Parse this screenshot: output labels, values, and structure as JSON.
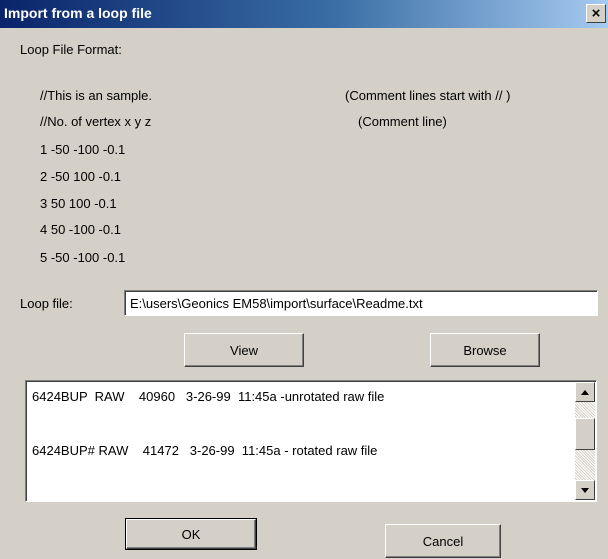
{
  "window": {
    "title": "Import from a loop file",
    "close_glyph": "×"
  },
  "format": {
    "heading": "Loop File Format:",
    "sample_lines": [
      "//This is an sample.",
      "//No. of vertex  x  y  z",
      "1  -50  -100  -0.1",
      "2  -50  100  -0.1",
      "3  50  100  -0.1",
      "4  50  -100  -0.1",
      "5  -50  -100  -0.1"
    ],
    "comments": [
      "(Comment lines start with // )",
      "(Comment line)"
    ]
  },
  "loop_file": {
    "label": "Loop file:",
    "value": "E:\\users\\Geonics EM58\\import\\surface\\Readme.txt"
  },
  "buttons": {
    "view": "View",
    "browse": "Browse",
    "ok": "OK",
    "cancel": "Cancel"
  },
  "listbox": {
    "lines": [
      "6424BUP  RAW    40960   3-26-99  11:45a -unrotated raw file",
      "6424BUP# RAW    41472   3-26-99  11:45a - rotated raw file"
    ]
  },
  "colors": {
    "dialog_bg": "#d4d0c8",
    "titlebar_start": "#0a246a",
    "titlebar_end": "#a6caf0"
  },
  "icons": {
    "close": "close-icon",
    "scroll_up": "scroll-up-icon",
    "scroll_down": "scroll-down-icon"
  }
}
